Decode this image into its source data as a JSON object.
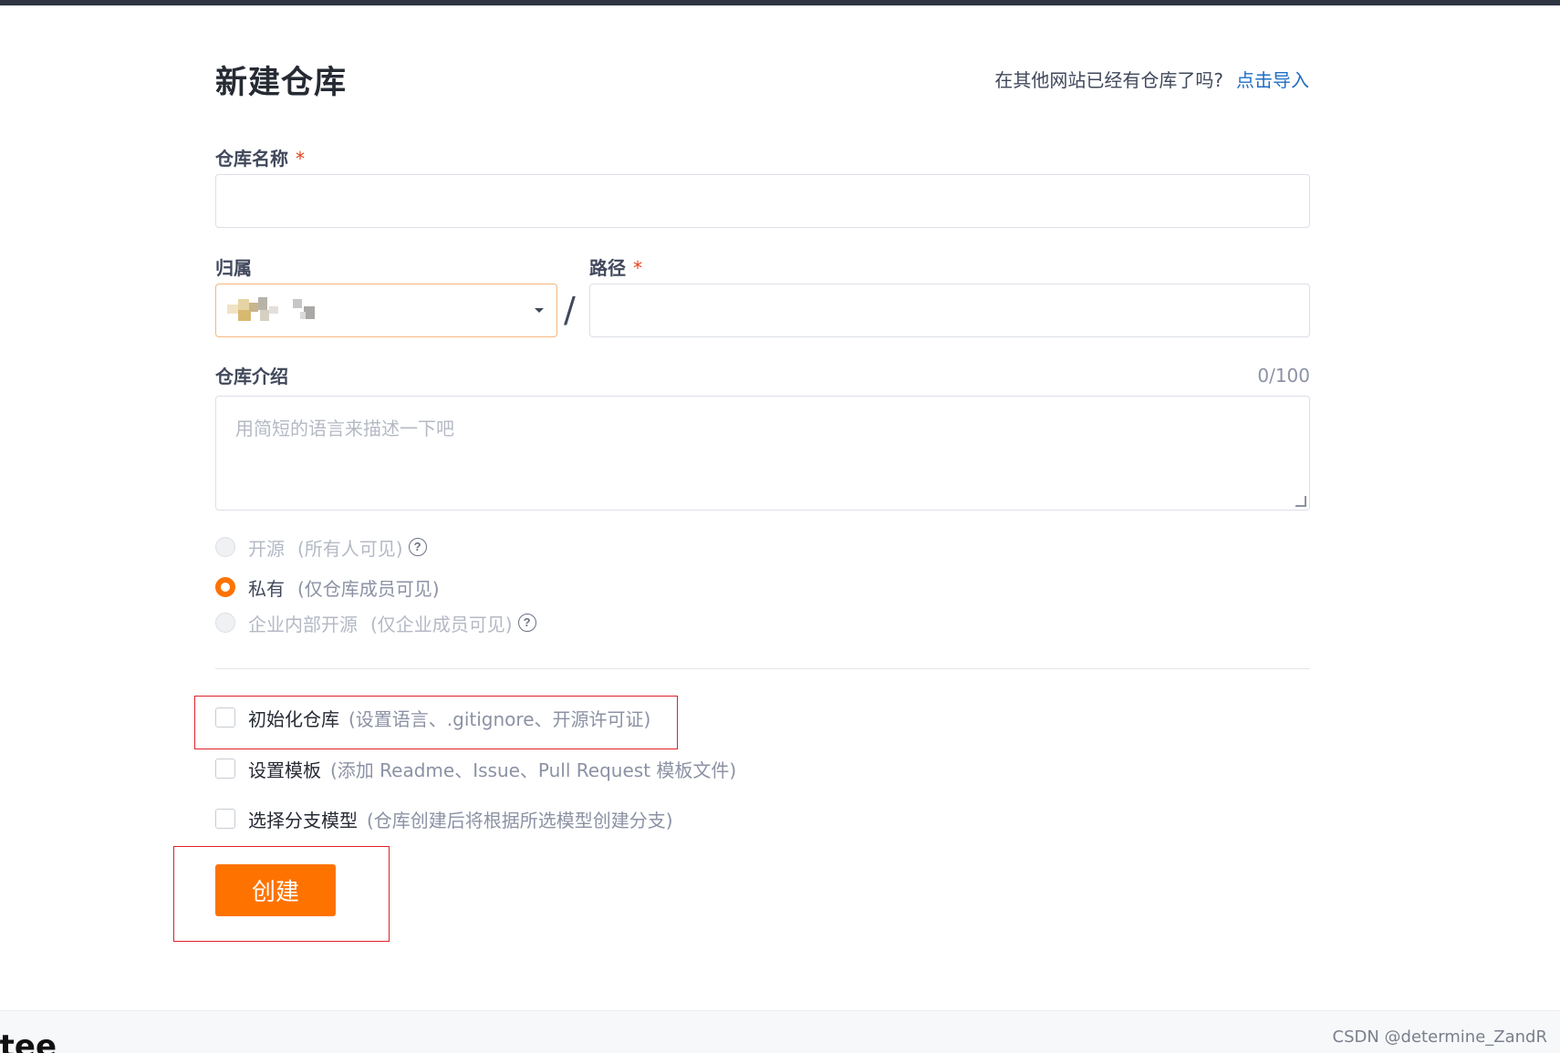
{
  "page": {
    "title": "新建仓库",
    "import_prompt": "在其他网站已经有仓库了吗?",
    "import_link": "点击导入"
  },
  "form": {
    "repo_name_label": "仓库名称",
    "required_mark": "*",
    "repo_name_value": "",
    "owner_label": "归属",
    "path_label": "路径",
    "path_separator": "/",
    "path_value": "",
    "description_label": "仓库介绍",
    "description_counter": "0/100",
    "description_placeholder": "用简短的语言来描述一下吧"
  },
  "visibility": [
    {
      "label": "开源",
      "hint": "(所有人可见)",
      "selected": false,
      "disabled": true
    },
    {
      "label": "私有",
      "hint": "(仅仓库成员可见)",
      "selected": true,
      "disabled": false
    },
    {
      "label": "企业内部开源",
      "hint": "(仅企业成员可见)",
      "selected": false,
      "disabled": true
    }
  ],
  "help_glyph": "?",
  "options": [
    {
      "label": "初始化仓库",
      "hint": "(设置语言、.gitignore、开源许可证)",
      "checked": false
    },
    {
      "label": "设置模板",
      "hint": "(添加 Readme、Issue、Pull Request 模板文件)",
      "checked": false
    },
    {
      "label": "选择分支模型",
      "hint": "(仓库创建后将根据所选模型创建分支)",
      "checked": false
    }
  ],
  "actions": {
    "create_label": "创建"
  },
  "footer": {
    "logo_text": "itee",
    "watermark": "CSDN @determine_ZandR"
  },
  "colors": {
    "accent": "#fe7300",
    "link": "#1f6ec4",
    "required": "#e84118",
    "annotation_box": "#e0202a"
  }
}
